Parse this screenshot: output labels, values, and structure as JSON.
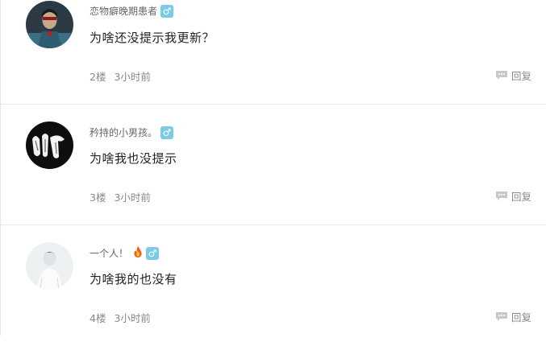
{
  "comments": [
    {
      "username": "恋物癖晚期患者",
      "gender_symbol": "♂",
      "text": "为啥还没提示我更新？",
      "floor": "2楼",
      "time": "3小时前",
      "reply_label": "回复"
    },
    {
      "username": "矜持的小男孩。",
      "gender_symbol": "♂",
      "text": "为啥我也没提示",
      "floor": "3楼",
      "time": "3小时前",
      "reply_label": "回复"
    },
    {
      "username": "一个人！",
      "gender_symbol": "♂",
      "text": "为啥我的也没有",
      "floor": "4楼",
      "time": "3小时前",
      "reply_label": "回复"
    }
  ],
  "colors": {
    "badge": "#7ccbe6",
    "meta_text": "#888888",
    "divider": "#e9e9e9"
  }
}
